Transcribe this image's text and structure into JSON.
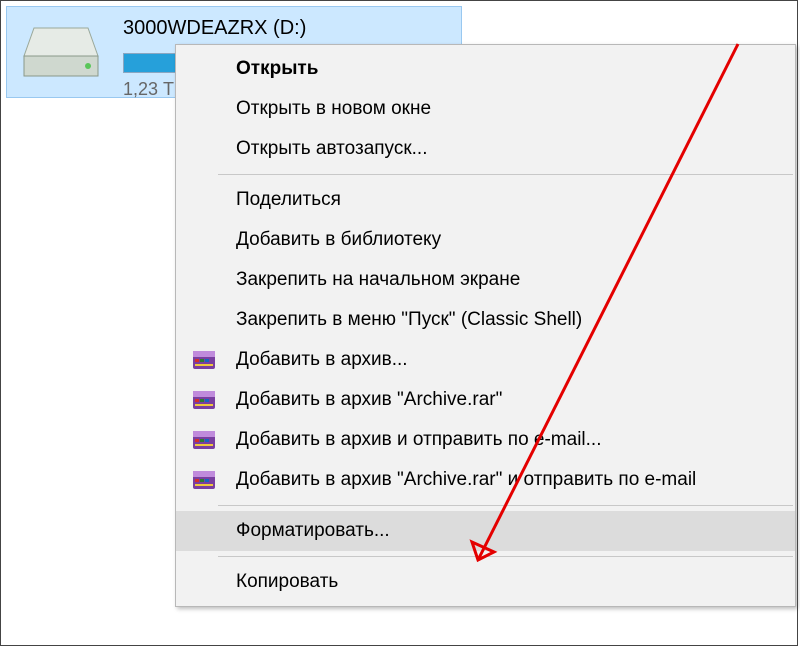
{
  "drive": {
    "label": "3000WDEAZRX (D:)",
    "sublabel": "1,23 Т"
  },
  "menu": {
    "open": "Открыть",
    "open_new_window": "Открыть в новом окне",
    "open_autorun": "Открыть автозапуск...",
    "share": "Поделиться",
    "add_library": "Добавить в библиотеку",
    "pin_start": "Закрепить на начальном экране",
    "pin_classic": "Закрепить в меню \"Пуск\" (Classic Shell)",
    "rar_add": "Добавить в архив...",
    "rar_add_named": "Добавить в архив \"Archive.rar\"",
    "rar_email": "Добавить в архив и отправить по e-mail...",
    "rar_named_email": "Добавить в архив \"Archive.rar\" и отправить по e-mail",
    "format": "Форматировать...",
    "copy": "Копировать"
  }
}
